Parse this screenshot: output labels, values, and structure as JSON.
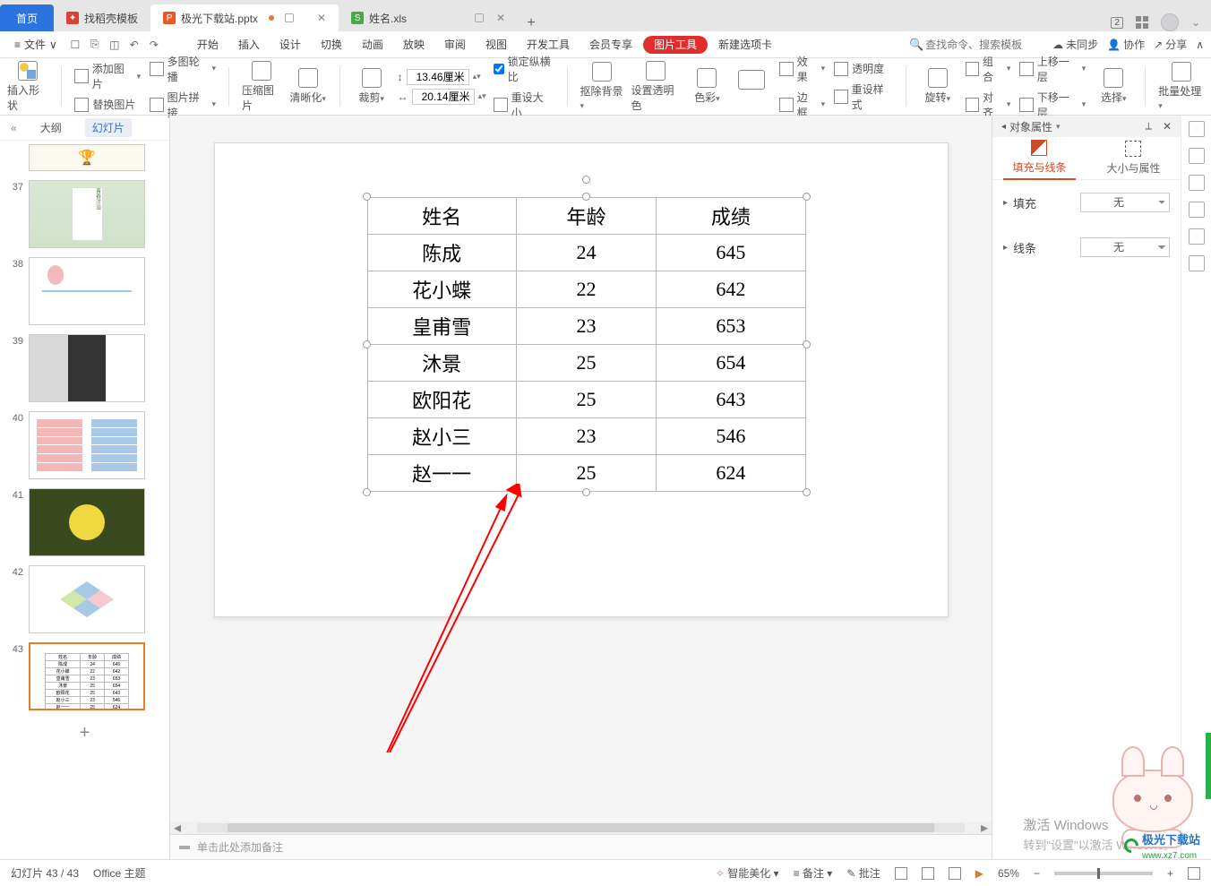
{
  "tabs": {
    "home": "首页",
    "template": "找稻壳模板",
    "file1": "极光下载站.pptx",
    "file2": "姓名.xls"
  },
  "topright": {
    "num": "2"
  },
  "menu": {
    "file": "文件",
    "items": [
      "开始",
      "插入",
      "设计",
      "切换",
      "动画",
      "放映",
      "审阅",
      "视图",
      "开发工具",
      "会员专享"
    ],
    "pic_tool": "图片工具",
    "new_tab": "新建选项卡",
    "search_ph": "查找命令、搜索模板",
    "unsync": "未同步",
    "coop": "协作",
    "share": "分享"
  },
  "ribbon": {
    "insert_shape": "插入形状",
    "add_image": "添加图片",
    "replace_image": "替换图片",
    "multi_crop": "多图轮播",
    "image_join": "图片拼接",
    "compress": "压缩图片",
    "sharpen": "清晰化",
    "crop": "裁剪",
    "h_label": "↕",
    "w_label": "↔",
    "h_val": "13.46厘米",
    "w_val": "20.14厘米",
    "lock_ratio": "锁定纵横比",
    "reset_size": "重设大小",
    "remove_bg": "抠除背景",
    "set_trans": "设置透明色",
    "color": "色彩",
    "effect": "效果",
    "transparency": "透明度",
    "border": "边框",
    "reset_style": "重设样式",
    "rotate": "旋转",
    "group": "组合",
    "align": "对齐",
    "up_layer": "上移一层",
    "down_layer": "下移一层",
    "select": "选择",
    "batch": "批量处理"
  },
  "slidepanel": {
    "collapse": "«",
    "outline": "大纲",
    "slides": "幻灯片",
    "nums": [
      "37",
      "38",
      "39",
      "40",
      "41",
      "42",
      "43"
    ]
  },
  "chart_data": {
    "type": "table",
    "headers": [
      "姓名",
      "年龄",
      "成绩"
    ],
    "rows": [
      [
        "陈成",
        "24",
        "645"
      ],
      [
        "花小蝶",
        "22",
        "642"
      ],
      [
        "皇甫雪",
        "23",
        "653"
      ],
      [
        "沐景",
        "25",
        "654"
      ],
      [
        "欧阳花",
        "25",
        "643"
      ],
      [
        "赵小三",
        "23",
        "546"
      ],
      [
        "赵一一",
        "25",
        "624"
      ]
    ]
  },
  "notes": {
    "placeholder": "单击此处添加备注"
  },
  "rightpanel": {
    "title": "对象属性",
    "tab1": "填充与线条",
    "tab2": "大小与属性",
    "fill": "填充",
    "line": "线条",
    "none": "无"
  },
  "status": {
    "slide": "幻灯片 43 / 43",
    "theme": "Office 主题",
    "smart": "智能美化",
    "remark": "备注",
    "review": "批注",
    "zoom": "65%"
  },
  "watermark": {
    "l1": "激活 Windows",
    "l2": "转到\"设置\"以激活 Windows。"
  },
  "site": {
    "name": "极光下载站",
    "url": "www.xz7.com"
  },
  "bunny": {
    "key1": "C",
    "key2": "♡"
  }
}
